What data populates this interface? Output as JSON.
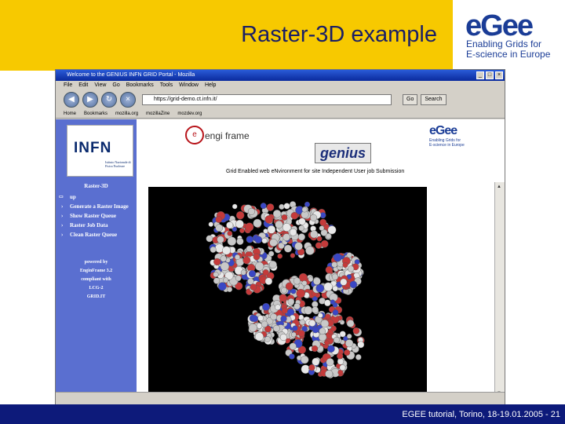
{
  "slide": {
    "title": "Raster-3D example",
    "footer": "EGEE tutorial, Torino, 18-19.01.2005  - 21",
    "logo": {
      "word": "eGee",
      "tagline_1": "Enabling Grids for",
      "tagline_2": "E-science in Europe"
    }
  },
  "browser": {
    "window_title": "Welcome to the GENIUS INFN GRID Portal - Mozilla",
    "menu": [
      "File",
      "Edit",
      "View",
      "Go",
      "Bookmarks",
      "Tools",
      "Window",
      "Help"
    ],
    "url": "https://grid-demo.ct.infn.it/",
    "go_label": "Go",
    "search_label": "Search",
    "bookmarks": [
      "Home",
      "Bookmarks",
      "mozilla.org",
      "mozillaZine",
      "mozdev.org"
    ]
  },
  "portal": {
    "infn_logo": "INFN",
    "infn_sub": "Istituto Nazionale di Fisica Nucleare",
    "sidebar_heading": "Raster-3D",
    "menu": [
      "up",
      "Generate a Raster Image",
      "Show Raster Queue",
      "Raster Job Data",
      "Clean Raster Queue"
    ],
    "powered": [
      "powered by",
      "EnginFrame 3.2",
      "compliant with",
      "LCG-2",
      "GRID.IT"
    ],
    "engiframe": "engi frame",
    "genius": "genius",
    "egee_small": "eGee",
    "egee_small_tag_1": "Enabling Grids for",
    "egee_small_tag_2": "E-science in Europe",
    "grid_line": "Grid Enabled web eNvironment for site Independent User job Submission"
  },
  "colors": {
    "title_band": "#f7c900",
    "footer": "#0d1a7a",
    "sidebar": "#5a6fd0"
  }
}
